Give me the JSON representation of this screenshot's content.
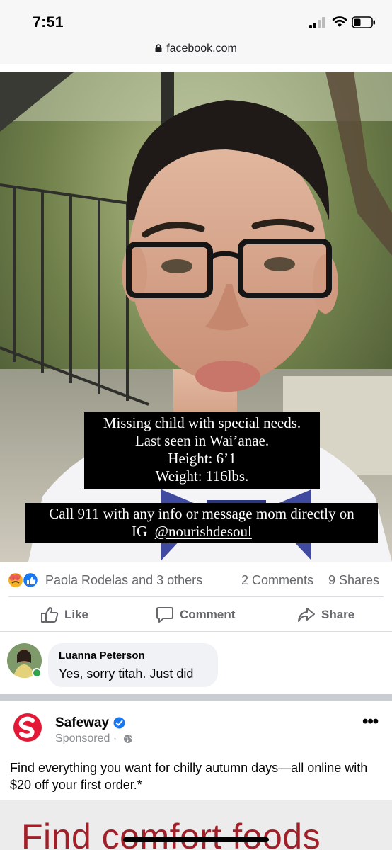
{
  "status_bar": {
    "time": "7:51"
  },
  "browser": {
    "url": "facebook.com"
  },
  "post": {
    "image_caption_lines": [
      "Missing child with special needs.",
      "Last seen in Wai’anae.",
      "Height: 6’1",
      "Weight: 116lbs."
    ],
    "image_caption2_line1": "Call 911 with any info or message mom directly on",
    "image_caption2_line2_prefix": "IG",
    "image_caption2_handle": "@nourishdesoul",
    "reaction_names": "Paola Rodelas and 3 others",
    "comments_count": "2 Comments",
    "shares_count": "9 Shares",
    "actions": {
      "like": "Like",
      "comment": "Comment",
      "share": "Share"
    }
  },
  "comment": {
    "author": "Luanna Peterson",
    "text": "Yes, sorry titah. Just did"
  },
  "sponsored_post": {
    "advertiser": "Safeway",
    "sponsored_label": "Sponsored ·",
    "text": "Find everything you want for chilly autumn days—all online with $20 off your first order.*",
    "image_headline": "Find comfort foods",
    "brand_color": "#e31837"
  },
  "colors": {
    "accent": "#1877f2",
    "secondary_text": "#65676b",
    "online": "#31a24c"
  }
}
